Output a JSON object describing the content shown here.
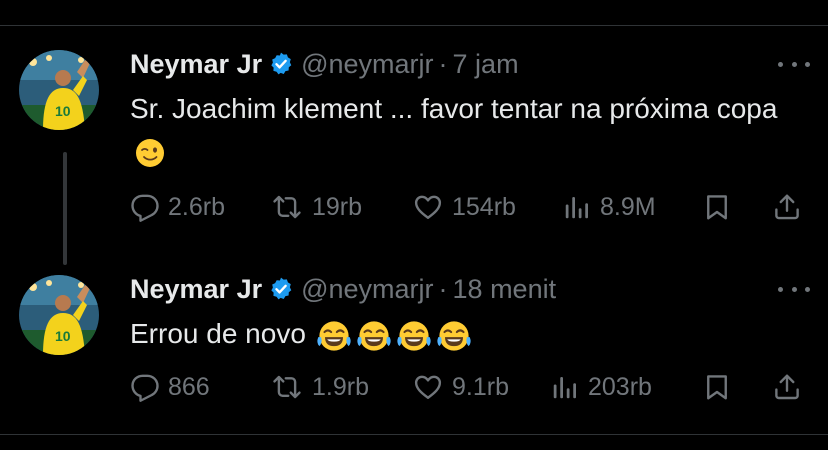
{
  "tweets": [
    {
      "display_name": "Neymar Jr",
      "handle": "@neymarjr",
      "separator": "·",
      "time": "7 jam",
      "text": "Sr. Joachim klement ... favor tentar na próxima copa",
      "emojis": [
        "winking-face-emoji"
      ],
      "replies": "2.6rb",
      "retweets": "19rb",
      "likes": "154rb",
      "views": "8.9M"
    },
    {
      "display_name": "Neymar Jr",
      "handle": "@neymarjr",
      "separator": "·",
      "time": "18 menit",
      "text": "Errou de novo",
      "emojis": [
        "tears-of-joy-emoji",
        "tears-of-joy-emoji",
        "tears-of-joy-emoji",
        "tears-of-joy-emoji"
      ],
      "replies": "866",
      "retweets": "1.9rb",
      "likes": "9.1rb",
      "views": "203rb"
    }
  ],
  "colors": {
    "background": "#000000",
    "text_primary": "#e7e9ea",
    "text_secondary": "#71767b",
    "verified_blue": "#1d9bf0",
    "divider": "#2f3336"
  },
  "icons": [
    "reply-icon",
    "retweet-icon",
    "like-icon",
    "views-icon",
    "bookmark-icon",
    "share-icon",
    "more-icon",
    "verified-badge-icon"
  ]
}
